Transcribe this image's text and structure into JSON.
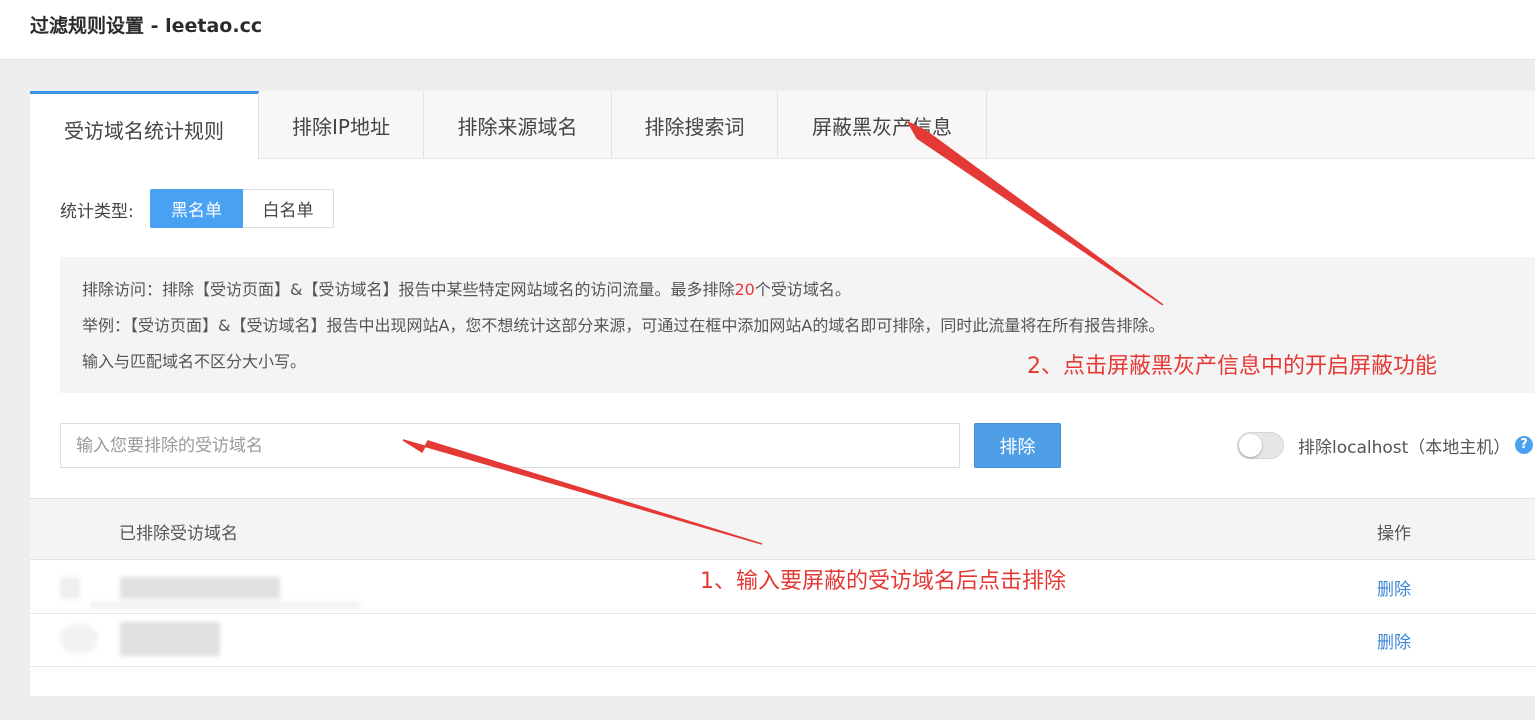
{
  "page": {
    "title": "过滤规则设置 - leetao.cc"
  },
  "tabs": [
    {
      "label": "受访域名统计规则",
      "active": true
    },
    {
      "label": "排除IP地址",
      "active": false
    },
    {
      "label": "排除来源域名",
      "active": false
    },
    {
      "label": "排除搜索词",
      "active": false
    },
    {
      "label": "屏蔽黑灰产信息",
      "active": false
    }
  ],
  "stat_type": {
    "label": "统计类型:",
    "options": [
      "黑名单",
      "白名单"
    ],
    "selected": "黑名单"
  },
  "info": {
    "line1_prefix": "排除访问：排除【受访页面】&【受访域名】报告中某些特定网站域名的访问流量。最多排除",
    "line1_count": "20",
    "line1_suffix": "个受访域名。",
    "line2": "举例：【受访页面】&【受访域名】报告中出现网站A，您不想统计这部分来源，可通过在框中添加网站A的域名即可排除，同时此流量将在所有报告排除。",
    "line3": "输入与匹配域名不区分大小写。"
  },
  "form": {
    "placeholder": "输入您要排除的受访域名",
    "value": "",
    "submit_label": "排除",
    "toggle_label": "排除localhost（本地主机）",
    "toggle_on": false,
    "help_icon": "question-circle-icon"
  },
  "table": {
    "columns": [
      "已排除受访域名",
      "操作"
    ],
    "rows": [
      {
        "domain": "",
        "action": "删除"
      },
      {
        "domain": "",
        "action": "删除"
      }
    ]
  },
  "annotations": {
    "step1": "1、输入要屏蔽的受访域名后点击排除",
    "step2": "2、点击屏蔽黑灰产信息中的开启屏蔽功能",
    "color": "#e53935"
  },
  "colors": {
    "accent": "#49a1f3",
    "link": "#3c85d6",
    "highlight": "#e53935"
  }
}
